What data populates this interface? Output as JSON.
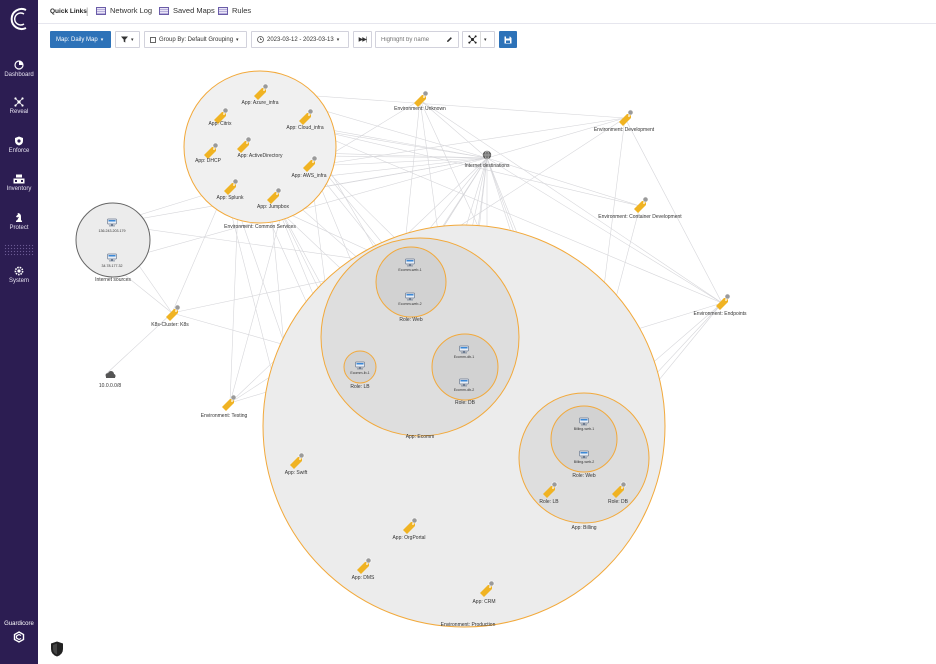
{
  "sidebar": {
    "items": [
      {
        "label": "Dashboard",
        "icon": "pie-chart-icon"
      },
      {
        "label": "Reveal",
        "icon": "network-icon"
      },
      {
        "label": "Enforce",
        "icon": "shield-icon"
      },
      {
        "label": "Inventory",
        "icon": "inventory-icon"
      },
      {
        "label": "Protect",
        "icon": "chess-knight-icon"
      },
      {
        "label": "System",
        "icon": "gear-icon"
      }
    ],
    "brand": "Guardicore"
  },
  "quick_links": {
    "title": "Quick Links",
    "separator": "|",
    "links": [
      {
        "label": "Network Log",
        "icon": "table-icon"
      },
      {
        "label": "Saved Maps",
        "icon": "table-icon"
      },
      {
        "label": "Rules",
        "icon": "table-icon"
      }
    ]
  },
  "toolbar": {
    "map_label": "Map: Daily Map",
    "group_by": "Group By: Default Grouping",
    "date_range": "2023-03-12 - 2023-03-13",
    "highlight_placeholder": "Highlight by name"
  },
  "map": {
    "nodes": {
      "app_azure_infra": "App: Azure_infra",
      "app_citrix": "App: Citrix",
      "app_cloud_infra": "App: Cloud_infra",
      "app_dhcp": "App: DHCP",
      "app_active_directory": "App: ActiveDirectory",
      "app_aws_infra": "App: AWS_infra",
      "app_splunk": "App: Splunk",
      "app_jumpbox": "App: Jumpbox",
      "env_common_services": "Environment: Common Services",
      "env_unknown": "Environment: Unknown",
      "internet_destinations": "Internet destinations",
      "env_development": "Environment: Development",
      "env_container_development": "Environment: Container Development",
      "internet_sources": "Internet sources",
      "internet_source_1": "136.243.203.179",
      "internet_source_2": "34.78.177.32",
      "k8s_cluster": "K8s-Cluster: K8s",
      "subnet": "10.0.0.0/8",
      "env_testing": "Environment: Testing",
      "env_endpoints": "Environment: Endpoints",
      "ecomm_web_1": "Ecomm-web-1",
      "ecomm_web_2": "Ecomm-web-2",
      "role_web": "Role: Web",
      "ecomm_lb_1": "Ecomm-lb-1",
      "role_lb": "Role: LB",
      "ecomm_db_1": "Ecomm-db-1",
      "ecomm_db_2": "Ecomm-db-2",
      "role_db": "Role: DB",
      "app_ecomm": "App: Ecomm",
      "billing_web_1": "Billing-web-1",
      "billing_web_2": "Billing-web-2",
      "billing_role_web": "Role: Web",
      "billing_role_lb": "Role: LB",
      "billing_role_db": "Role: DB",
      "app_billing": "App: Billing",
      "app_swift": "App: Swift",
      "app_orgportal": "App: OrgPortal",
      "app_dms": "App: DMS",
      "app_crm": "App: CRM",
      "env_production": "Environment: Production"
    }
  },
  "colors": {
    "sidebar_bg": "#2c1d52",
    "accent_blue": "#2d72b8",
    "group_ring": "#f2a93b",
    "label_icon": "#f0b323"
  }
}
